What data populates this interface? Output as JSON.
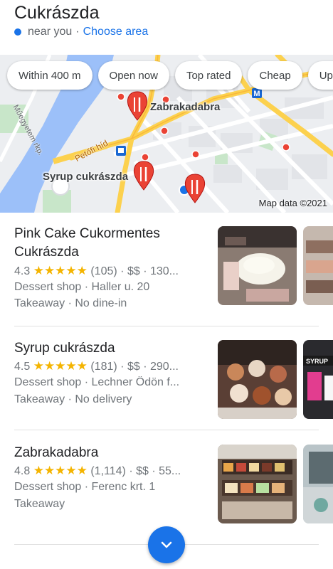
{
  "header": {
    "title": "Cukrászda",
    "location_text": "near you",
    "separator": "·",
    "choose_area": "Choose area"
  },
  "filters": [
    "Within 400 m",
    "Open now",
    "Top rated",
    "Cheap",
    "Ups"
  ],
  "map": {
    "labels": {
      "zabrakadabra": "Zabrakadabra",
      "syrup": "Syrup cukrászda",
      "petofi": "Petőfi híd",
      "muegyetem": "Műegyetem rkp."
    },
    "metro_badge": "M",
    "credit": "Map data ©2021"
  },
  "results": [
    {
      "name": "Pink Cake Cukormentes Cukrászda",
      "rating": "4.3",
      "stars": "★★★★★",
      "reviews": "(105)",
      "price": "· $$ · 130...",
      "category": "Dessert shop · Haller u. 20",
      "service": "Takeaway · No dine-in"
    },
    {
      "name": "Syrup cukrászda",
      "rating": "4.5",
      "stars": "★★★★★",
      "reviews": "(181)",
      "price": "· $$ · 290...",
      "category": "Dessert shop · Lechner Ödön f...",
      "service": "Takeaway · No delivery",
      "photo_sign": "SYRUP"
    },
    {
      "name": "Zabrakadabra",
      "rating": "4.8",
      "stars": "★★★★★",
      "reviews": "(1,114)",
      "price": "· $$ · 55...",
      "category": "Dessert shop · Ferenc krt. 1",
      "service": "Takeaway"
    }
  ],
  "colors": {
    "accent": "#1a73e8",
    "star": "#f4b400",
    "pin": "#ea4335",
    "river": "#9cc0f9",
    "major_road": "#fcd14e"
  },
  "icons": {
    "location": "blue-dot-icon",
    "pin": "restaurant-pin-icon",
    "expand": "chevron-down-icon"
  }
}
